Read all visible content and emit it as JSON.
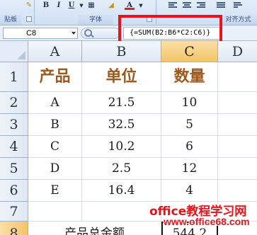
{
  "ribbon": {
    "clipboard_label": "贴板",
    "font_label": "字体",
    "alignment_label": "对齐方式",
    "icons": {
      "bold": "B",
      "italic": "I",
      "underline": "U",
      "font_color": "A"
    }
  },
  "formula_bar": {
    "name_box": "C8",
    "formula": "{=SUM(B2:B6*C2:C6)}",
    "highlight_color": "#e8131b"
  },
  "sheet": {
    "columns": [
      "A",
      "B",
      "C",
      "D"
    ],
    "selected_column": "C",
    "rows": [
      "1",
      "2",
      "3",
      "4",
      "5",
      "6",
      "7",
      "8"
    ],
    "selected_row": "8",
    "header_row": [
      "产品",
      "单位",
      "数量"
    ],
    "data_rows": [
      [
        "A",
        "21.5",
        "10"
      ],
      [
        "B",
        "32.5",
        "5"
      ],
      [
        "C",
        "10.2",
        "6"
      ],
      [
        "D",
        "2.5",
        "12"
      ],
      [
        "E",
        "16.4",
        "4"
      ]
    ],
    "total_label": "产品总金额",
    "total_value": "544.2"
  },
  "watermark": {
    "line1": "office教程学习网",
    "line2": "www.office68.com",
    "color": "#e8131b"
  }
}
